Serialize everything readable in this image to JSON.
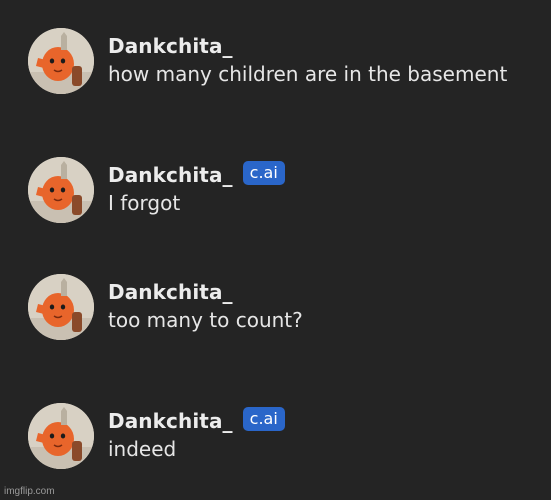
{
  "messages": [
    {
      "username": "Dankchita_",
      "badge": null,
      "text": "how many children are in the basement"
    },
    {
      "username": "Dankchita_",
      "badge": "c.ai",
      "text": "I forgot"
    },
    {
      "username": "Dankchita_",
      "badge": null,
      "text": "too many to count?"
    },
    {
      "username": "Dankchita_",
      "badge": "c.ai",
      "text": "indeed"
    }
  ],
  "watermark": "imgflip.com",
  "colors": {
    "background": "#242424",
    "username": "#ececec",
    "message_text": "#e6e6e6",
    "badge_bg": "#2a66c9",
    "avatar_character": "#e8652b"
  },
  "icons": {
    "avatar": "orange-chainsaw-dog-avatar-icon"
  }
}
